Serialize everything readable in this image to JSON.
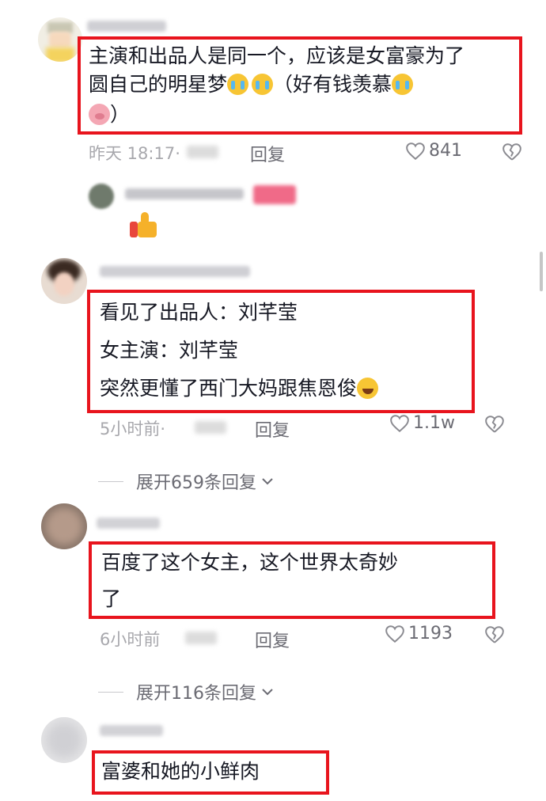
{
  "comments": [
    {
      "text_line1": "主演和出品人是同一个，应该是女富豪为了",
      "text_line2": "圆自己的明星梦",
      "text_line2_tail": "（好有钱羡慕",
      "text_line3_tail": "）",
      "time": "昨天 18:17·",
      "reply": "回复",
      "likes": "841"
    },
    {
      "text_line1": "看见了出品人：刘芊莹",
      "text_line2": "女主演：刘芊莹",
      "text_line3": "突然更懂了西门大妈跟焦恩俊",
      "time": "5小时前·",
      "reply": "回复",
      "likes": "1.1w",
      "expand": "展开659条回复"
    },
    {
      "text_line1": "百度了这个女主，这个世界太奇妙",
      "text_line2": "了",
      "time": "6小时前",
      "reply": "回复",
      "likes": "1193",
      "expand": "展开116条回复"
    },
    {
      "text_line1": "富婆和她的小鲜肉"
    }
  ],
  "icons": {
    "heart": "heart-outline-icon",
    "dislike": "broken-heart-icon",
    "chevron": "chevron-down-icon",
    "emoji_cry": "crying-emoji-icon",
    "emoji_pig": "pig-emoji-icon",
    "emoji_thumb": "thumbs-up-emoji-icon",
    "emoji_laugh": "laugh-cry-emoji-icon"
  },
  "colors": {
    "highlight": "#e8141d",
    "meta": "#a8a8ad",
    "text": "#161823"
  }
}
